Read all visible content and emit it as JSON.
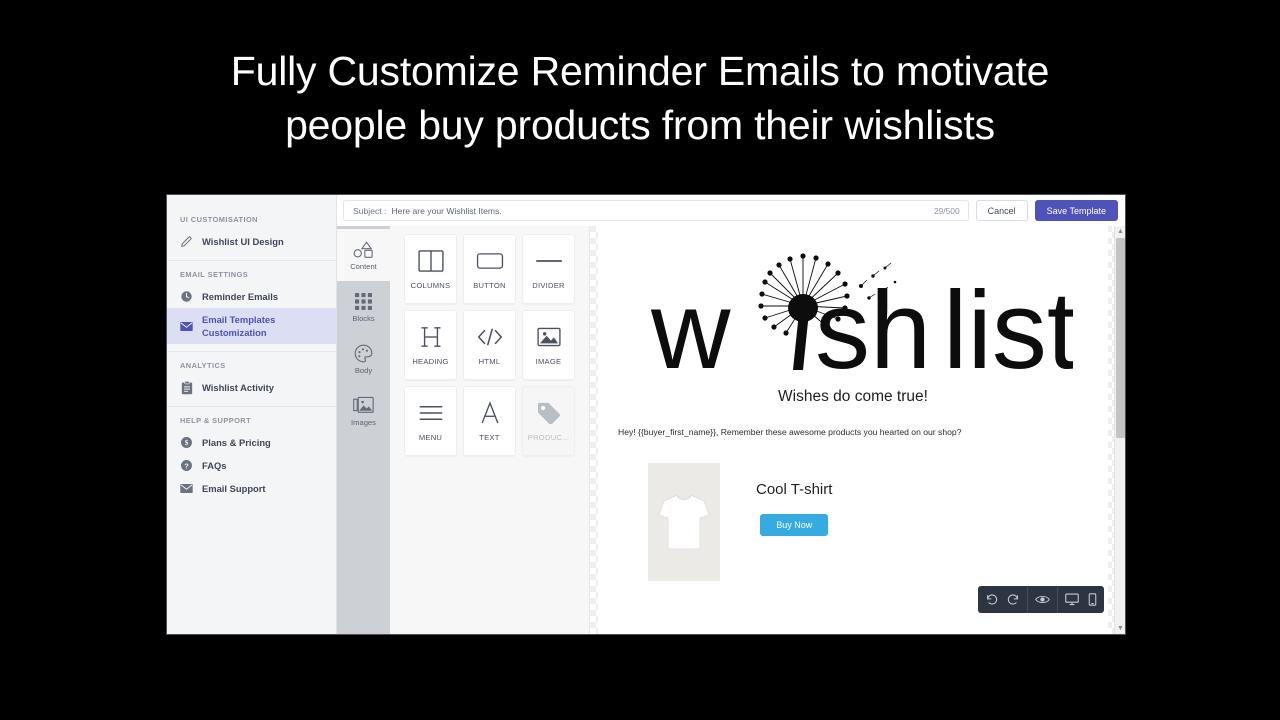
{
  "headline": {
    "line1": "Fully Customize Reminder Emails to motivate",
    "line2": "people buy products from their wishlists"
  },
  "sidebar": {
    "sections": [
      {
        "header": "UI CUSTOMISATION",
        "items": [
          {
            "label": "Wishlist UI Design",
            "icon": "pencil-icon",
            "active": false
          }
        ]
      },
      {
        "header": "EMAIL SETTINGS",
        "items": [
          {
            "label": "Reminder Emails",
            "icon": "clock-icon",
            "active": false
          },
          {
            "label": "Email Templates Customization",
            "icon": "envelope-icon",
            "active": true
          }
        ]
      },
      {
        "header": "ANALYTICS",
        "items": [
          {
            "label": "Wishlist Activity",
            "icon": "clipboard-icon",
            "active": false
          }
        ]
      },
      {
        "header": "HELP & SUPPORT",
        "items": [
          {
            "label": "Plans & Pricing",
            "icon": "dollar-circle-icon",
            "active": false
          },
          {
            "label": "FAQs",
            "icon": "question-circle-icon",
            "active": false
          },
          {
            "label": "Email Support",
            "icon": "envelope-icon",
            "active": false
          }
        ]
      }
    ]
  },
  "topbar": {
    "subject_label": "Subject :",
    "subject_value": "Here are your Wishlist Items.",
    "subject_count": "29/500",
    "cancel_label": "Cancel",
    "save_label": "Save Template"
  },
  "rail": {
    "tabs": [
      {
        "label": "Content",
        "icon": "shapes-icon",
        "active": true
      },
      {
        "label": "Blocks",
        "icon": "grid-icon",
        "active": false
      },
      {
        "label": "Body",
        "icon": "palette-icon",
        "active": false
      },
      {
        "label": "Images",
        "icon": "images-icon",
        "active": false
      }
    ]
  },
  "palette": {
    "blocks": [
      {
        "label": "COLUMNS",
        "icon": "columns-icon",
        "disabled": false
      },
      {
        "label": "BUTTON",
        "icon": "button-icon",
        "disabled": false
      },
      {
        "label": "DIVIDER",
        "icon": "divider-icon",
        "disabled": false
      },
      {
        "label": "HEADING",
        "icon": "heading-icon",
        "disabled": false
      },
      {
        "label": "HTML",
        "icon": "code-icon",
        "disabled": false
      },
      {
        "label": "IMAGE",
        "icon": "image-icon",
        "disabled": false
      },
      {
        "label": "MENU",
        "icon": "menu-icon",
        "disabled": false
      },
      {
        "label": "TEXT",
        "icon": "text-icon",
        "disabled": false
      },
      {
        "label": "PRODUC...",
        "icon": "tag-icon",
        "disabled": true
      }
    ]
  },
  "email": {
    "logo_text_w": "w",
    "logo_text_sh": "sh",
    "logo_text_list": "list",
    "logo_alt": "wishlist-dandelion-logo",
    "tagline": "Wishes do come true!",
    "greeting": "Hey! {{buyer_first_name}}, Remember these awesome products you hearted on our shop?",
    "product_title": "Cool T-shirt",
    "buy_now_label": "Buy Now",
    "product_image_alt": "white-t-shirt-photo"
  },
  "float_toolbar": {
    "undo": "undo-icon",
    "redo": "redo-icon",
    "preview": "eye-icon",
    "desktop": "desktop-icon",
    "mobile": "mobile-icon"
  },
  "colors": {
    "accent_indigo": "#4f52b8",
    "active_nav_bg": "#dcdef3",
    "buy_now_blue": "#35abe2",
    "toolbar_dark": "#2d3442",
    "rail_gray": "#cdd1d6"
  }
}
